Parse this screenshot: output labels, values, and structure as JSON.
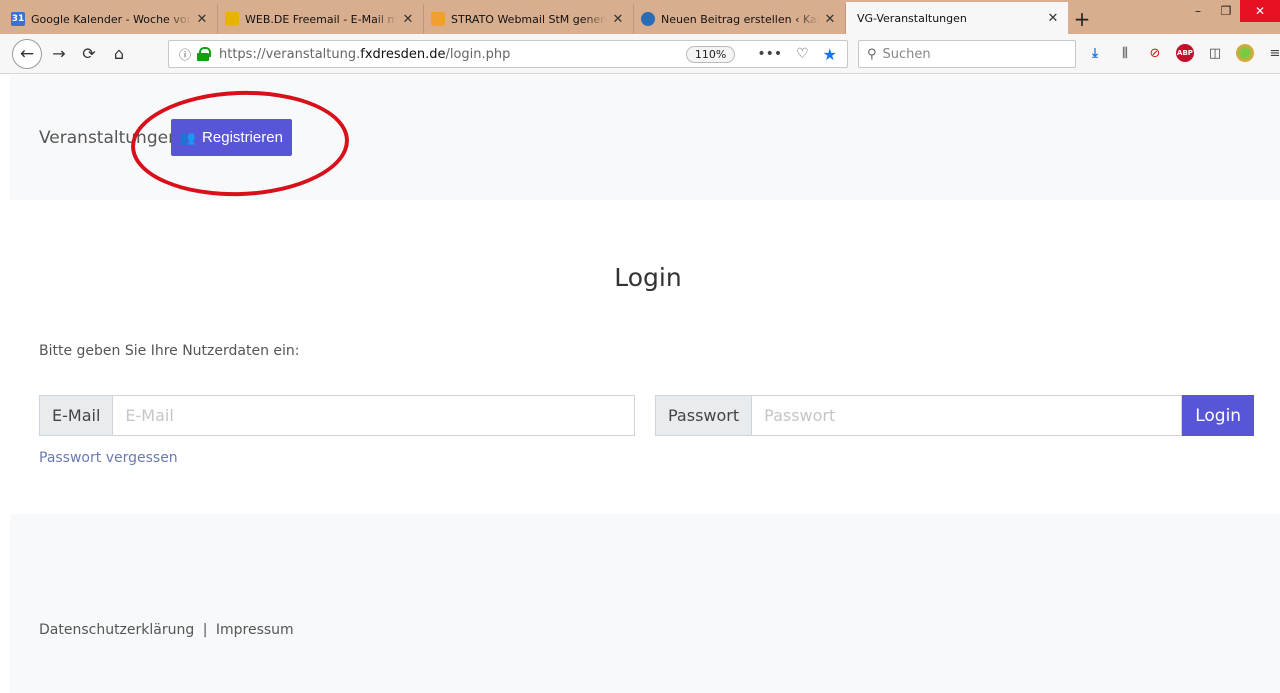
{
  "browser": {
    "tabs": [
      {
        "title": "Google Kalender - Woche vom",
        "favicon_text": "31",
        "favicon_color": "#3b6fd6"
      },
      {
        "title": "WEB.DE Freemail - E-Mail mad",
        "favicon_text": "",
        "favicon_color": "#e8b400"
      },
      {
        "title": "STRATO Webmail StM generell",
        "favicon_text": "",
        "favicon_color": "#f0a030"
      },
      {
        "title": "Neuen Beitrag erstellen ‹ Katho",
        "favicon_text": "",
        "favicon_color": "#2a6db5"
      },
      {
        "title": "VG-Veranstaltungen",
        "favicon_text": "",
        "favicon_color": ""
      }
    ],
    "url_prefix": "https://veranstaltung.",
    "url_domain": "fxdresden.de",
    "url_suffix": "/login.php",
    "zoom": "110%",
    "search_placeholder": "Suchen"
  },
  "nav": {
    "brand": "Veranstaltungen",
    "register_label": "Registrieren"
  },
  "login": {
    "title": "Login",
    "hint": "Bitte geben Sie Ihre Nutzerdaten ein:",
    "email_label": "E-Mail",
    "email_placeholder": "E-Mail",
    "password_label": "Passwort",
    "password_placeholder": "Passwort",
    "submit_label": "Login",
    "forgot_label": "Passwort vergessen"
  },
  "footer": {
    "privacy": "Datenschutzerklärung",
    "separator": "|",
    "imprint": "Impressum"
  },
  "colors": {
    "primary": "#5856d6",
    "annotation": "#d8101a"
  }
}
